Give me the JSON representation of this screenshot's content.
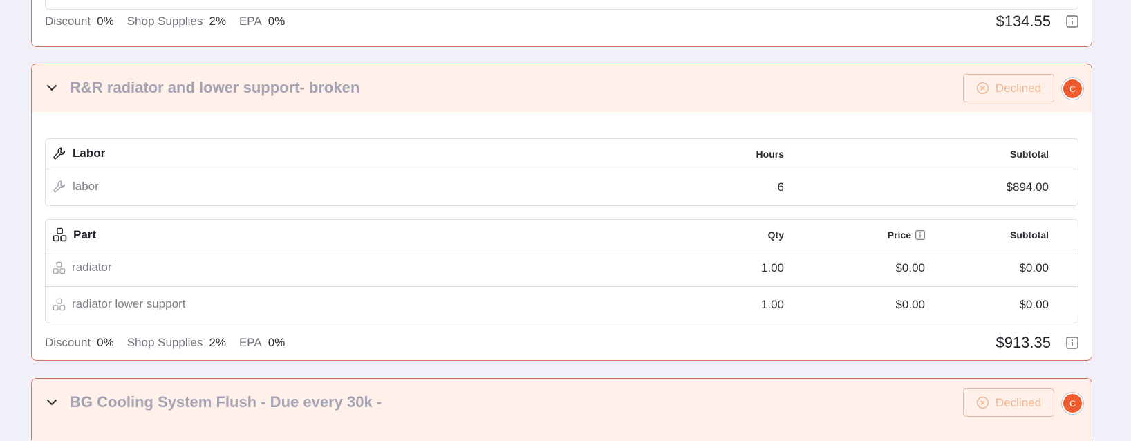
{
  "top_card": {
    "fees": {
      "discount_label": "Discount",
      "discount_value": "0%",
      "shop_supplies_label": "Shop Supplies",
      "shop_supplies_value": "2%",
      "epa_label": "EPA",
      "epa_value": "0%"
    },
    "total": "$134.55"
  },
  "main_card": {
    "title": "R&R radiator and lower support- broken",
    "status_label": "Declined",
    "avatar_initial": "C",
    "labor": {
      "header": "Labor",
      "col_hours": "Hours",
      "col_subtotal": "Subtotal",
      "rows": [
        {
          "name": "labor",
          "hours": "6",
          "subtotal": "$894.00"
        }
      ]
    },
    "parts": {
      "header": "Part",
      "col_qty": "Qty",
      "col_price": "Price",
      "col_subtotal": "Subtotal",
      "rows": [
        {
          "name": "radiator",
          "qty": "1.00",
          "price": "$0.00",
          "subtotal": "$0.00"
        },
        {
          "name": "radiator lower support",
          "qty": "1.00",
          "price": "$0.00",
          "subtotal": "$0.00"
        }
      ]
    },
    "fees": {
      "discount_label": "Discount",
      "discount_value": "0%",
      "shop_supplies_label": "Shop Supplies",
      "shop_supplies_value": "2%",
      "epa_label": "EPA",
      "epa_value": "0%"
    },
    "total": "$913.35"
  },
  "bottom_card": {
    "title": "BG Cooling System Flush - Due every 30k -",
    "status_label": "Declined",
    "avatar_initial": "C"
  },
  "colors": {
    "page_bg": "#f1f0f8",
    "card_border": "#d9735a",
    "header_bg": "#fff1ea",
    "declined_text": "#efb692",
    "avatar_bg": "#ee5b2c"
  },
  "icons": [
    "chevron-down-icon",
    "x-circle-icon",
    "wrench-icon",
    "parts-icon",
    "info-icon"
  ]
}
